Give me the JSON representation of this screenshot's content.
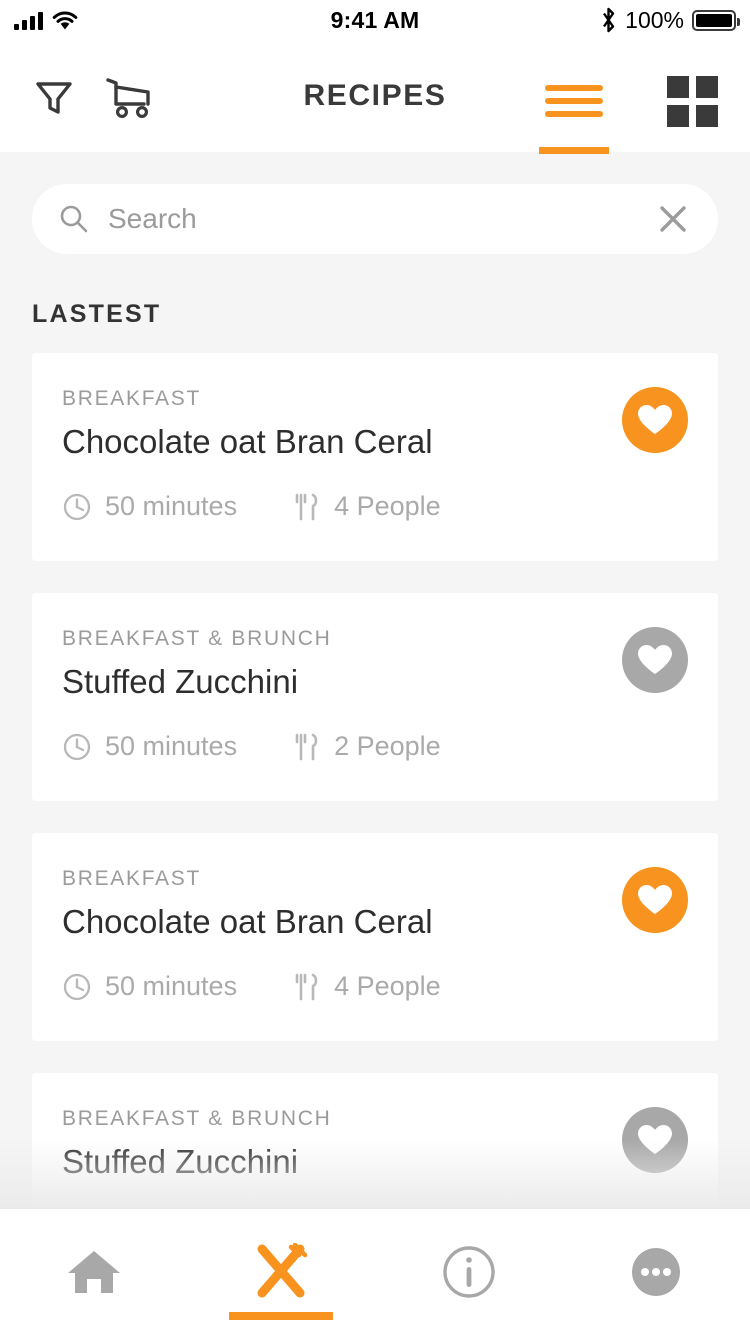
{
  "status_bar": {
    "signal_icon": "signal-bars-icon",
    "wifi_icon": "wifi-icon",
    "time": "9:41 AM",
    "bluetooth_icon": "bluetooth-icon",
    "battery_percent": "100%",
    "battery_icon": "battery-full-icon"
  },
  "header": {
    "title": "RECIPES",
    "filter_icon": "filter-funnel-icon",
    "cart_icon": "shopping-cart-icon",
    "list_view_icon": "list-view-icon",
    "grid_view_icon": "grid-view-icon",
    "active_view": "list"
  },
  "search": {
    "placeholder": "Search",
    "value": "",
    "search_icon": "search-icon",
    "clear_icon": "close-icon"
  },
  "section": {
    "title": "LASTEST"
  },
  "recipes": [
    {
      "category": "BREAKFAST",
      "title": "Chocolate oat Bran Ceral",
      "time": "50 minutes",
      "servings": "4 People",
      "favorite": true
    },
    {
      "category": "BREAKFAST & BRUNCH",
      "title": "Stuffed Zucchini",
      "time": "50 minutes",
      "servings": "2 People",
      "favorite": false
    },
    {
      "category": "BREAKFAST",
      "title": "Chocolate oat Bran Ceral",
      "time": "50 minutes",
      "servings": "4 People",
      "favorite": true
    },
    {
      "category": "BREAKFAST & BRUNCH",
      "title": "Stuffed Zucchini",
      "time": "",
      "servings": "",
      "favorite": false
    }
  ],
  "meta_icons": {
    "time_icon": "clock-icon",
    "servings_icon": "cutlery-icon"
  },
  "bottom_nav": {
    "items": [
      {
        "name": "home-icon",
        "active": false
      },
      {
        "name": "recipes-cutlery-icon",
        "active": true
      },
      {
        "name": "info-icon",
        "active": false
      },
      {
        "name": "more-icon",
        "active": false
      }
    ]
  },
  "colors": {
    "accent": "#f7931e",
    "inactive": "#a8a8a8",
    "dark": "#3a3a3a",
    "background": "#f5f5f5",
    "card": "#ffffff"
  }
}
